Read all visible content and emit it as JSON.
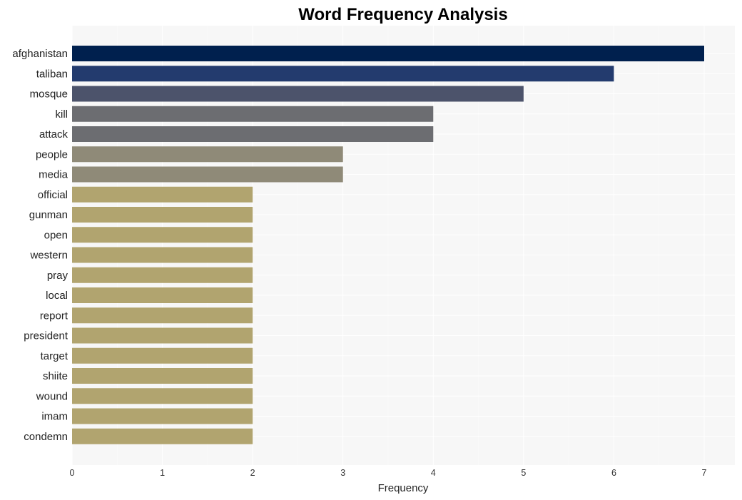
{
  "chart_data": {
    "type": "bar",
    "orientation": "horizontal",
    "title": "Word Frequency Analysis",
    "xlabel": "Frequency",
    "ylabel": "",
    "xlim": [
      0,
      7.35
    ],
    "xticks": [
      0,
      1,
      2,
      3,
      4,
      5,
      6,
      7
    ],
    "grid": true,
    "legend": "none",
    "categories": [
      "afghanistan",
      "taliban",
      "mosque",
      "kill",
      "attack",
      "people",
      "media",
      "official",
      "gunman",
      "open",
      "western",
      "pray",
      "local",
      "report",
      "president",
      "target",
      "shiite",
      "wound",
      "imam",
      "condemn"
    ],
    "values": [
      7,
      6,
      5,
      4,
      4,
      3,
      3,
      2,
      2,
      2,
      2,
      2,
      2,
      2,
      2,
      2,
      2,
      2,
      2,
      2
    ],
    "colors": [
      "#00204e",
      "#233b6e",
      "#4c536b",
      "#6c6d71",
      "#6c6d71",
      "#8f8a78",
      "#8f8a78",
      "#b1a46f",
      "#b1a46f",
      "#b1a46f",
      "#b1a46f",
      "#b1a46f",
      "#b1a46f",
      "#b1a46f",
      "#b1a46f",
      "#b1a46f",
      "#b1a46f",
      "#b1a46f",
      "#b1a46f",
      "#b1a46f"
    ]
  },
  "colors": {
    "plot_background": "#f7f7f7",
    "grid": "#ffffff"
  }
}
